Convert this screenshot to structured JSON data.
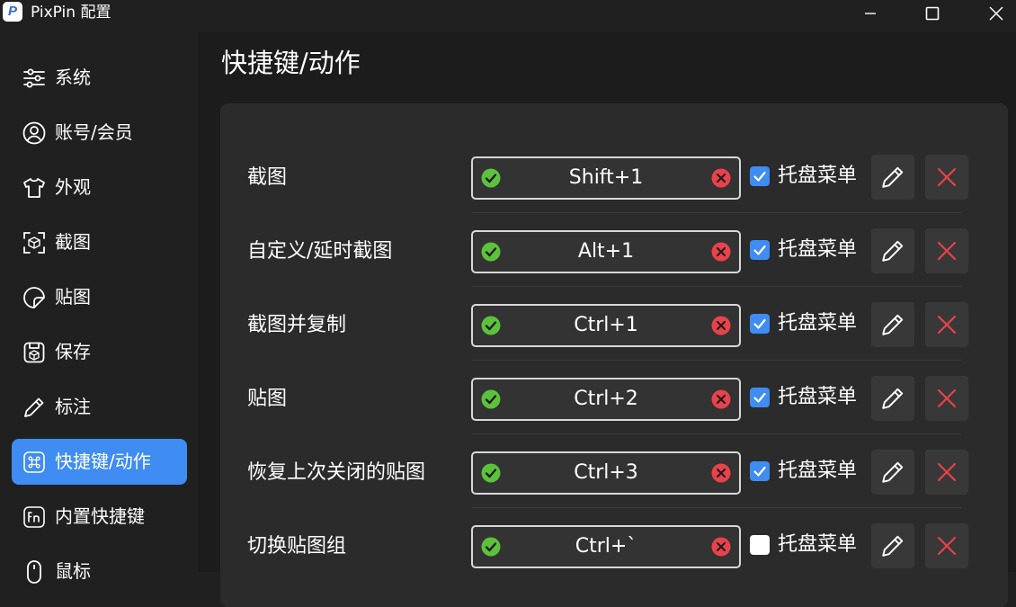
{
  "window": {
    "title": "PixPin 配置",
    "logo_letter": "P"
  },
  "sidebar": {
    "items": [
      {
        "label": "系统",
        "icon": "sliders-icon",
        "active": false
      },
      {
        "label": "账号/会员",
        "icon": "user-icon",
        "active": false
      },
      {
        "label": "外观",
        "icon": "shirt-icon",
        "active": false
      },
      {
        "label": "截图",
        "icon": "screenshot-icon",
        "active": false
      },
      {
        "label": "贴图",
        "icon": "sticker-icon",
        "active": false
      },
      {
        "label": "保存",
        "icon": "save-icon",
        "active": false
      },
      {
        "label": "标注",
        "icon": "pencil-icon",
        "active": false
      },
      {
        "label": "快捷键/动作",
        "icon": "command-key-icon",
        "active": true
      },
      {
        "label": "内置快捷键",
        "icon": "fn-key-icon",
        "active": false
      },
      {
        "label": "鼠标",
        "icon": "mouse-icon",
        "active": false
      }
    ]
  },
  "main": {
    "title": "快捷键/动作",
    "rows": [
      {
        "label": "截图",
        "shortcut": "Shift+1",
        "tray_label": "托盘菜单",
        "tray_checked": true
      },
      {
        "label": "自定义/延时截图",
        "shortcut": "Alt+1",
        "tray_label": "托盘菜单",
        "tray_checked": true
      },
      {
        "label": "截图并复制",
        "shortcut": "Ctrl+1",
        "tray_label": "托盘菜单",
        "tray_checked": true
      },
      {
        "label": "贴图",
        "shortcut": "Ctrl+2",
        "tray_label": "托盘菜单",
        "tray_checked": true
      },
      {
        "label": "恢复上次关闭的贴图",
        "shortcut": "Ctrl+3",
        "tray_label": "托盘菜单",
        "tray_checked": true
      },
      {
        "label": "切换贴图组",
        "shortcut": "Ctrl+`",
        "tray_label": "托盘菜单",
        "tray_checked": false
      }
    ]
  },
  "colors": {
    "accent": "#3f8cf2",
    "ok": "#5cc23c",
    "danger": "#e8424a"
  }
}
